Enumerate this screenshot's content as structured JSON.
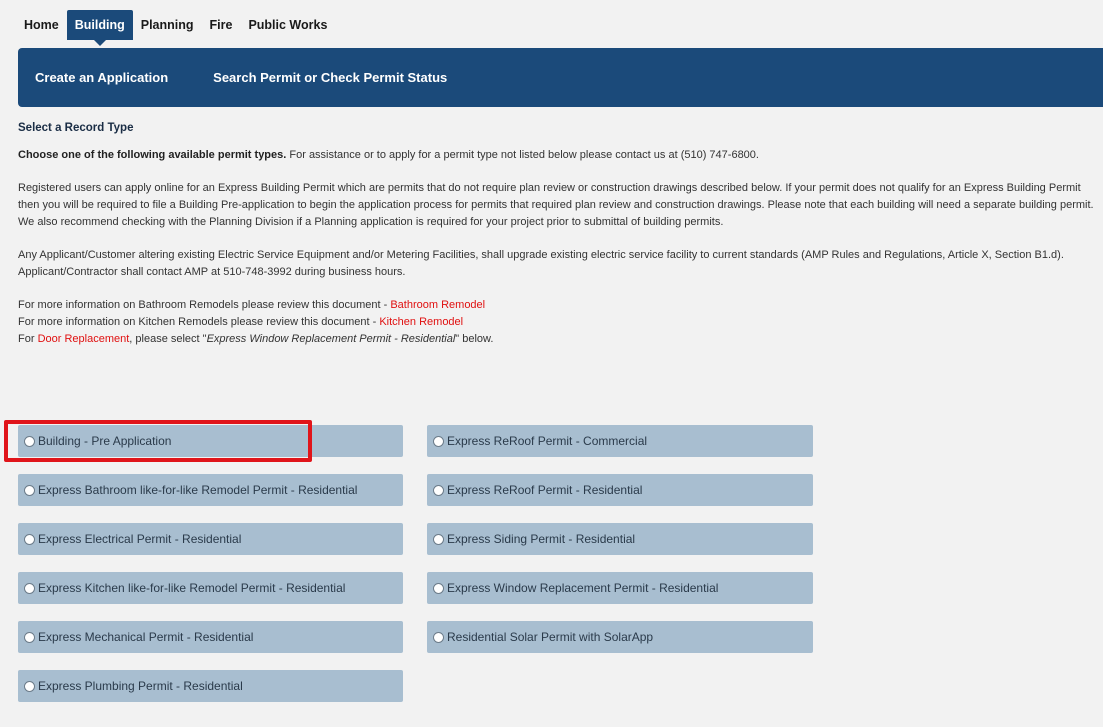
{
  "top_tabs": [
    {
      "label": "Home"
    },
    {
      "label": "Building",
      "active": true
    },
    {
      "label": "Planning"
    },
    {
      "label": "Fire"
    },
    {
      "label": "Public Works"
    }
  ],
  "sub_nav": [
    {
      "label": "Create an Application"
    },
    {
      "label": "Search Permit or Check Permit Status"
    }
  ],
  "content": {
    "section_title": "Select a Record Type",
    "intro_bold": "Choose one of the following available permit types.",
    "intro_rest": " For assistance or to apply for a permit type not listed below please contact us at (510) 747-6800.",
    "para1": "Registered users can apply online for an Express Building Permit which are permits that do not require plan review or construction drawings described below. If your permit does not qualify for an Express Building Permit then you will be required to file a Building Pre-application to begin the application process for permits that required plan review and construction drawings. Please note that each building will need a separate building permit. We also recommend checking with the Planning Division if a Planning application is required for your project prior to submittal of building permits.",
    "para2": "Any Applicant/Customer altering existing Electric Service Equipment and/or Metering Facilities, shall upgrade existing electric service facility to current standards (AMP Rules and Regulations, Article X, Section B1.d). Applicant/Contractor shall contact AMP at 510-748-3992 during business hours.",
    "info1_prefix": "For more information on Bathroom Remodels please review this document - ",
    "info1_link": "Bathroom Remodel",
    "info2_prefix": "For more information on Kitchen Remodels please review this document - ",
    "info2_link": "Kitchen Remodel",
    "info3_prefix": "For ",
    "info3_link": "Door Replacement",
    "info3_mid": ", please select \"",
    "info3_italic": "Express Window Replacement Permit - Residential",
    "info3_suffix": "\" below."
  },
  "permits_left": [
    "Building - Pre Application",
    "Express Bathroom like-for-like Remodel Permit - Residential",
    "Express Electrical Permit - Residential",
    "Express Kitchen like-for-like Remodel Permit - Residential",
    "Express Mechanical Permit - Residential",
    "Express Plumbing Permit - Residential"
  ],
  "permits_right": [
    "Express ReRoof Permit - Commercial",
    "Express ReRoof Permit - Residential",
    "Express Siding Permit - Residential",
    "Express Window Replacement Permit - Residential",
    "Residential Solar Permit with SolarApp"
  ],
  "colors": {
    "nav_blue": "#1b4a7a",
    "option_bg": "#a8bed0",
    "link_red": "#e01010",
    "highlight_red": "#e0141a"
  }
}
